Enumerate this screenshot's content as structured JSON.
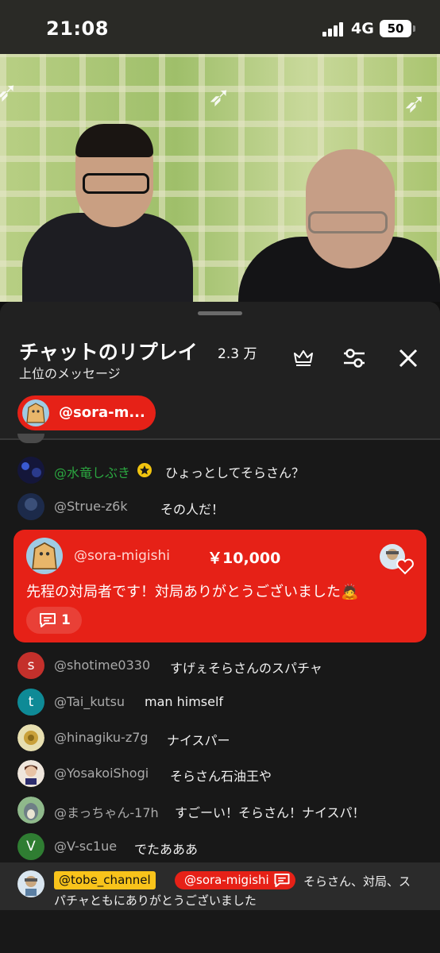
{
  "status_bar": {
    "time": "21:08",
    "network": "4G",
    "battery": "50"
  },
  "panel": {
    "title": "チャットのリプレイ",
    "count": "2.3 万",
    "subtitle": "上位のメッセージ",
    "icons": [
      "crown-icon",
      "settings-sliders-icon",
      "close-icon"
    ]
  },
  "pinned": {
    "label": "@sora-m..."
  },
  "messages_top": [
    {
      "author": "@水竜しぶき",
      "author_color": "#2ba640",
      "verified": true,
      "text": "ひょっとしてそらさん？"
    },
    {
      "author": "@Strue-z6k",
      "text": "その人だ！"
    }
  ],
  "superchat": {
    "author": "@sora-migishi",
    "amount": "￥10,000",
    "text": "先程の対局者です！対局ありがとうございました🙇",
    "reply_count": "1",
    "color": "#e62117"
  },
  "messages_bottom": [
    {
      "avatar_letter": "s",
      "avatar_color": "#c4302b",
      "author": "@shotime0330",
      "text": "すげぇそらさんのスパチャ"
    },
    {
      "avatar_letter": "t",
      "avatar_color": "#0e8a96",
      "author": "@Tai_kutsu",
      "text": "man himself"
    },
    {
      "avatar_letter": "",
      "avatar_color": "#e7dfb0",
      "author": "@hinagiku-z7g",
      "text": "ナイスパー"
    },
    {
      "avatar_letter": "",
      "avatar_color": "#efe6dc",
      "author": "@YosakoiShogi",
      "text": "そらさん石油王や"
    },
    {
      "avatar_letter": "",
      "avatar_color": "#8fb98b",
      "author": "@まっちゃん-17h",
      "text": "すごーい！そらさん！ナイスパ！"
    },
    {
      "avatar_letter": "V",
      "avatar_color": "#2f7d32",
      "author": "@V-sc1ue",
      "text": "でたあああ"
    }
  ],
  "highlighted": {
    "owner_tag": "@tobe_channel",
    "mention_tag": "@sora-migishi",
    "text_line1": "そらさん、対局、ス",
    "text_line2": "パチャともにありがとうございました"
  }
}
